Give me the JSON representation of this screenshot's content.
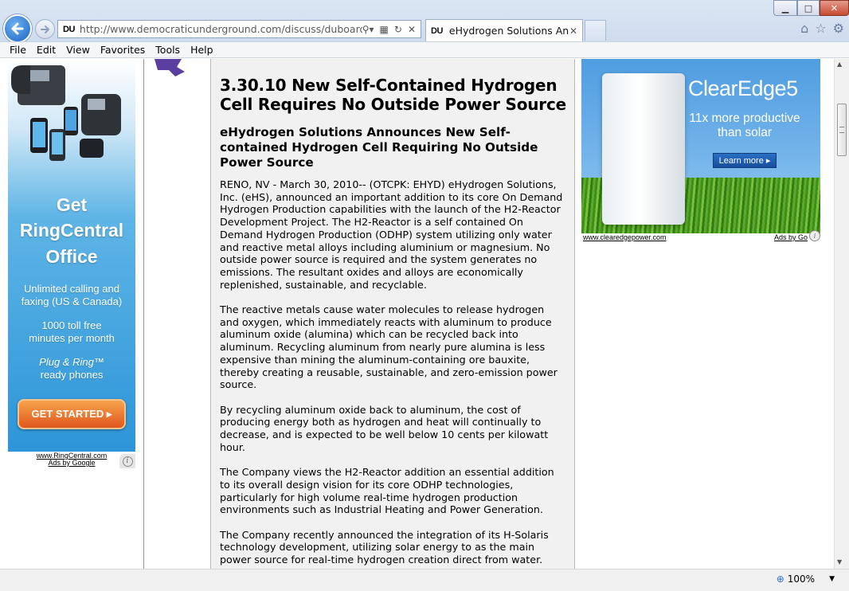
{
  "window": {
    "minimize_label": "▁",
    "maximize_label": "□",
    "close_label": "✕"
  },
  "nav": {
    "back_icon": "back-arrow-icon",
    "forward_icon": "forward-arrow-icon"
  },
  "address_bar": {
    "favicon_text": "DU",
    "url": "http://www.democraticunderground.com/discuss/duboard.php?"
  },
  "tab": {
    "favicon_text": "DU",
    "title": "eHydrogen Solutions Anno...",
    "close": "✕"
  },
  "menu": {
    "items": [
      "File",
      "Edit",
      "View",
      "Favorites",
      "Tools",
      "Help"
    ]
  },
  "left_ad": {
    "headline_1": "Get",
    "headline_2": "RingCentral",
    "headline_3": "Office",
    "line_1": "Unlimited calling and",
    "line_2": "faxing (US & Canada)",
    "line_3": "1000 toll free",
    "line_4": "minutes per month",
    "line_5": "Plug & Ring™",
    "line_6": "ready phones",
    "cta": "GET STARTED ▸",
    "footer_url": "www.RingCentral.com",
    "footer_ads": "Ads by Google"
  },
  "article": {
    "title": "3.30.10 New Self-Contained Hydrogen Cell Requires No Outside Power Source",
    "subtitle": "eHydrogen Solutions Announces New Self-contained Hydrogen Cell Requiring No Outside Power Source",
    "paragraphs": [
      "RENO, NV - March 30, 2010-- (OTCPK: EHYD) eHydrogen Solutions, Inc. (eHS), announced an important addition to its core On Demand Hydrogen Production capabilities with the launch of the H2-Reactor Development Project. The H2-Reactor is a self contained On Demand Hydrogen Production (ODHP) system utilizing only water and reactive metal alloys including aluminium or magnesium. No outside power source is required and the system generates no emissions. The resultant oxides and alloys are economically replenished, sustainable, and recyclable.",
      "The reactive metals cause water molecules to release hydrogen and oxygen, which immediately reacts with aluminum to produce aluminum oxide (alumina) which can be recycled back into aluminum. Recycling aluminum from nearly pure alumina is less expensive than mining the aluminum-containing ore bauxite, thereby creating a reusable, sustainable, and zero-emission power source.",
      "By recycling aluminum oxide back to aluminum, the cost of producing energy both as hydrogen and heat will continually to decrease, and is expected to be well below 10 cents per kilowatt hour.",
      "The Company views the H2-Reactor addition an essential addition to its overall design vision for its core ODHP technologies, particularly for high volume real-time hydrogen production environments such as Industrial Heating and Power Generation.",
      "The Company recently announced the integration of its H-Solaris technology development, utilizing solar energy to as the main power source for real-time hydrogen creation direct from water."
    ]
  },
  "right_ad": {
    "brand": "ClearEdge5",
    "tagline_1": "11x more productive",
    "tagline_2": "than solar",
    "button": "Learn more ▸",
    "footer_url": "www.clearedgepower.com",
    "footer_ads": "Ads by Go"
  },
  "status": {
    "zoom": "100%"
  }
}
